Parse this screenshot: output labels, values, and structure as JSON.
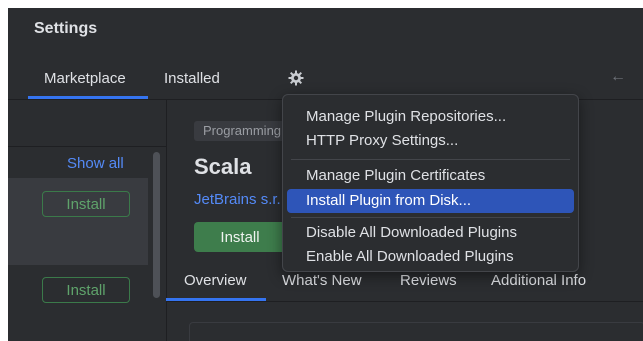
{
  "window": {
    "title": "Settings"
  },
  "tabs": {
    "marketplace": "Marketplace",
    "installed": "Installed"
  },
  "icons": {
    "gear": "gear-icon",
    "back": "arrow-left-icon"
  },
  "sidebar": {
    "show_all": "Show all",
    "install_label": "Install"
  },
  "plugin": {
    "category": "Programming Languages",
    "name": "Scala",
    "vendor": "JetBrains s.r.o.",
    "install_label": "Install"
  },
  "detail_tabs": {
    "overview": "Overview",
    "whats_new": "What's New",
    "reviews": "Reviews",
    "additional_info": "Additional Info"
  },
  "menu": {
    "items": [
      "Manage Plugin Repositories...",
      "HTTP Proxy Settings...",
      "Manage Plugin Certificates",
      "Install Plugin from Disk...",
      "Disable All Downloaded Plugins",
      "Enable All Downloaded Plugins"
    ],
    "selected_index": 3
  },
  "colors": {
    "background": "#2b2d30",
    "accent": "#3574f0",
    "link": "#548af7",
    "selection": "#2e55b8",
    "install_green": "#3e7d4c"
  }
}
